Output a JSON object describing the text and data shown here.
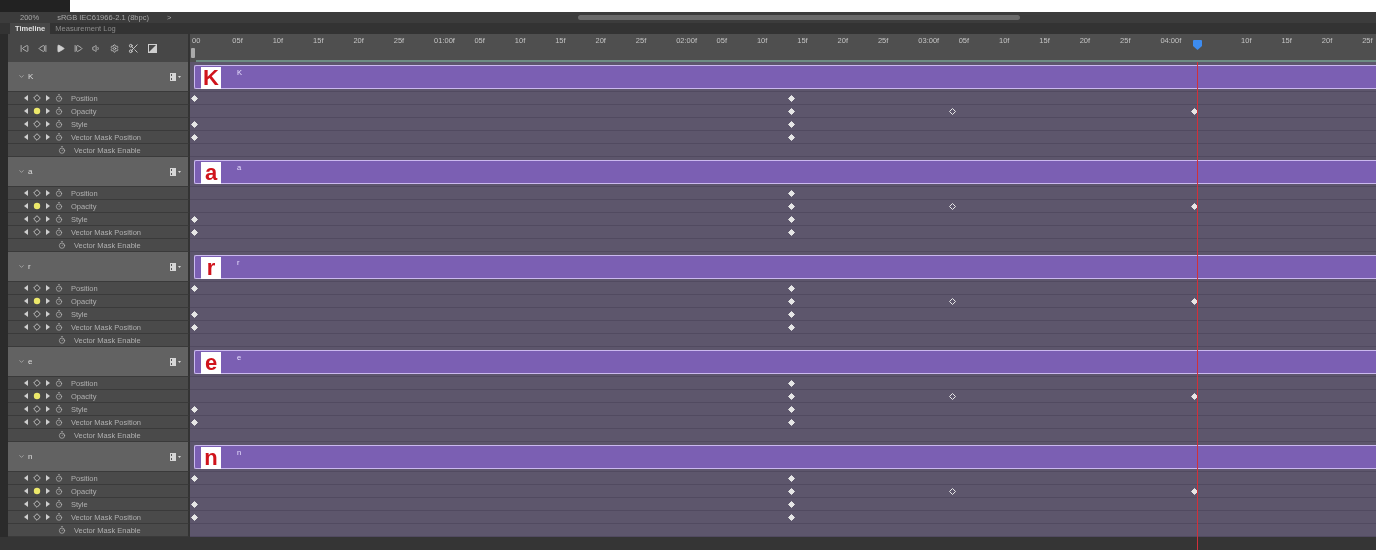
{
  "document_bar": {
    "zoom": "200%",
    "profile": "sRGB IEC61966-2.1 (8bpc)",
    "arrow": ">"
  },
  "panel_tabs": [
    {
      "label": "Timeline",
      "selected": true
    },
    {
      "label": "Measurement Log",
      "selected": false
    }
  ],
  "ruler": {
    "labels": [
      "00",
      "05f",
      "10f",
      "15f",
      "20f",
      "25f",
      "01:00f",
      "05f",
      "10f",
      "15f",
      "20f",
      "25f",
      "02:00f",
      "05f",
      "10f",
      "15f",
      "20f",
      "25f",
      "03:00f",
      "05f",
      "10f",
      "15f",
      "20f",
      "25f",
      "04:00f",
      "10f",
      "15f",
      "20f",
      "25f"
    ]
  },
  "playhead": {
    "level": 0.8486
  },
  "layers": [
    {
      "name": "K",
      "thumb": "K",
      "bar_label": "K",
      "expanded": true,
      "properties": [
        {
          "name": "Position",
          "kind": "keyframed",
          "keyed": false,
          "keyframes": [
            {
              "level": 0.0034,
              "kind": "filled"
            },
            {
              "level": 0.5078,
              "kind": "filled"
            }
          ]
        },
        {
          "name": "Opacity",
          "kind": "keyframed",
          "keyed": true,
          "keyframes": [
            {
              "level": 0.5078,
              "kind": "filled"
            },
            {
              "level": 0.6441,
              "kind": "hollow"
            },
            {
              "level": 0.8486,
              "kind": "filled"
            }
          ]
        },
        {
          "name": "Style",
          "kind": "keyframed",
          "keyed": false,
          "keyframes": [
            {
              "level": 0.0034,
              "kind": "filled"
            },
            {
              "level": 0.5078,
              "kind": "filled"
            }
          ]
        },
        {
          "name": "Vector Mask Position",
          "kind": "keyframed",
          "keyed": false,
          "keyframes": [
            {
              "level": 0.0034,
              "kind": "filled"
            },
            {
              "level": 0.5078,
              "kind": "filled"
            }
          ]
        },
        {
          "name": "Vector Mask Enable",
          "kind": "toggle"
        }
      ]
    },
    {
      "name": "a",
      "thumb": "a",
      "bar_label": "a",
      "expanded": true,
      "properties": [
        {
          "name": "Position",
          "kind": "keyframed",
          "keyed": false,
          "keyframes": [
            {
              "level": 0.5078,
              "kind": "filled"
            }
          ]
        },
        {
          "name": "Opacity",
          "kind": "keyframed",
          "keyed": true,
          "keyframes": [
            {
              "level": 0.5078,
              "kind": "filled"
            },
            {
              "level": 0.6441,
              "kind": "hollow"
            },
            {
              "level": 0.8486,
              "kind": "filled"
            }
          ]
        },
        {
          "name": "Style",
          "kind": "keyframed",
          "keyed": false,
          "keyframes": [
            {
              "level": 0.0034,
              "kind": "filled"
            },
            {
              "level": 0.5078,
              "kind": "filled"
            }
          ]
        },
        {
          "name": "Vector Mask Position",
          "kind": "keyframed",
          "keyed": false,
          "keyframes": [
            {
              "level": 0.0034,
              "kind": "filled"
            },
            {
              "level": 0.5078,
              "kind": "filled"
            }
          ]
        },
        {
          "name": "Vector Mask Enable",
          "kind": "toggle"
        }
      ]
    },
    {
      "name": "r",
      "thumb": "r",
      "bar_label": "r",
      "expanded": true,
      "properties": [
        {
          "name": "Position",
          "kind": "keyframed",
          "keyed": false,
          "keyframes": [
            {
              "level": 0.0034,
              "kind": "filled"
            },
            {
              "level": 0.5078,
              "kind": "filled"
            }
          ]
        },
        {
          "name": "Opacity",
          "kind": "keyframed",
          "keyed": true,
          "keyframes": [
            {
              "level": 0.5078,
              "kind": "filled"
            },
            {
              "level": 0.6441,
              "kind": "hollow"
            },
            {
              "level": 0.8486,
              "kind": "filled"
            }
          ]
        },
        {
          "name": "Style",
          "kind": "keyframed",
          "keyed": false,
          "keyframes": [
            {
              "level": 0.0034,
              "kind": "filled"
            },
            {
              "level": 0.5078,
              "kind": "filled"
            }
          ]
        },
        {
          "name": "Vector Mask Position",
          "kind": "keyframed",
          "keyed": false,
          "keyframes": [
            {
              "level": 0.0034,
              "kind": "filled"
            },
            {
              "level": 0.5078,
              "kind": "filled"
            }
          ]
        },
        {
          "name": "Vector Mask Enable",
          "kind": "toggle"
        }
      ]
    },
    {
      "name": "e",
      "thumb": "e",
      "bar_label": "e",
      "expanded": true,
      "properties": [
        {
          "name": "Position",
          "kind": "keyframed",
          "keyed": false,
          "keyframes": [
            {
              "level": 0.5078,
              "kind": "filled"
            }
          ]
        },
        {
          "name": "Opacity",
          "kind": "keyframed",
          "keyed": true,
          "keyframes": [
            {
              "level": 0.5078,
              "kind": "filled"
            },
            {
              "level": 0.6441,
              "kind": "hollow"
            },
            {
              "level": 0.8486,
              "kind": "filled"
            }
          ]
        },
        {
          "name": "Style",
          "kind": "keyframed",
          "keyed": false,
          "keyframes": [
            {
              "level": 0.0034,
              "kind": "filled"
            },
            {
              "level": 0.5078,
              "kind": "filled"
            }
          ]
        },
        {
          "name": "Vector Mask Position",
          "kind": "keyframed",
          "keyed": false,
          "keyframes": [
            {
              "level": 0.0034,
              "kind": "filled"
            },
            {
              "level": 0.5078,
              "kind": "filled"
            }
          ]
        },
        {
          "name": "Vector Mask Enable",
          "kind": "toggle"
        }
      ]
    },
    {
      "name": "n",
      "thumb": "n",
      "bar_label": "n",
      "expanded": true,
      "properties": [
        {
          "name": "Position",
          "kind": "keyframed",
          "keyed": false,
          "keyframes": [
            {
              "level": 0.0034,
              "kind": "filled"
            },
            {
              "level": 0.5078,
              "kind": "filled"
            }
          ]
        },
        {
          "name": "Opacity",
          "kind": "keyframed",
          "keyed": true,
          "keyframes": [
            {
              "level": 0.5078,
              "kind": "filled"
            },
            {
              "level": 0.6441,
              "kind": "hollow"
            },
            {
              "level": 0.8486,
              "kind": "filled"
            }
          ]
        },
        {
          "name": "Style",
          "kind": "keyframed",
          "keyed": false,
          "keyframes": [
            {
              "level": 0.0034,
              "kind": "filled"
            },
            {
              "level": 0.5078,
              "kind": "filled"
            }
          ]
        },
        {
          "name": "Vector Mask Position",
          "kind": "keyframed",
          "keyed": false,
          "keyframes": [
            {
              "level": 0.0034,
              "kind": "filled"
            },
            {
              "level": 0.5078,
              "kind": "filled"
            }
          ]
        },
        {
          "name": "Vector Mask Enable",
          "kind": "toggle"
        }
      ]
    }
  ]
}
